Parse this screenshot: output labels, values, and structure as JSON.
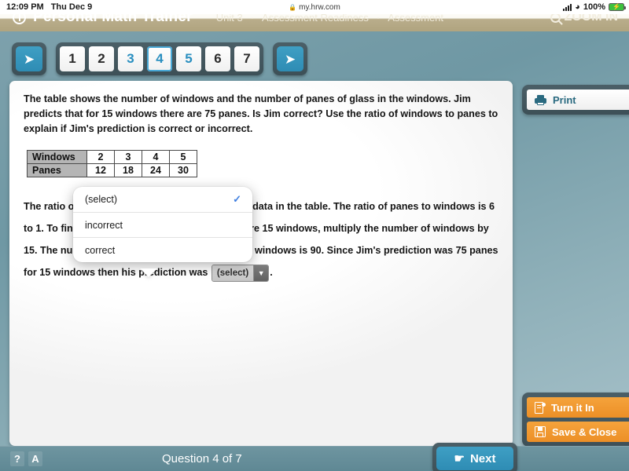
{
  "statusbar": {
    "time": "12:09 PM",
    "date": "Thu Dec 9",
    "url": "my.hrw.com",
    "lock_icon": "lock-icon",
    "signal_icon": "signal-bars-icon",
    "wifi_icon": "wifi-icon",
    "battery_pct": "100%",
    "battery_icon": "battery-charging-icon"
  },
  "header": {
    "logo_icon": "pmt-logo-icon",
    "title": "Personal Math Trainer",
    "breadcrumb": [
      "Unit 3",
      "Assessment Readiness",
      "Assessment"
    ],
    "zoom_label": "ZOOM IN",
    "zoom_icon": "magnifier-icon"
  },
  "nav": {
    "prev_icon": "arrow-left-icon",
    "next_icon": "arrow-right-icon",
    "pages": [
      {
        "label": "1",
        "state": "visited"
      },
      {
        "label": "2",
        "state": "visited"
      },
      {
        "label": "3",
        "state": "link"
      },
      {
        "label": "4",
        "state": "current"
      },
      {
        "label": "5",
        "state": "link"
      },
      {
        "label": "6",
        "state": "visited"
      },
      {
        "label": "7",
        "state": "visited"
      }
    ]
  },
  "question": {
    "prompt": "The table shows the number of windows and the number of panes of glass in the windows. Jim predicts that for 15 windows there are 75 panes. Is Jim correct? Use the ratio of windows to panes to explain if Jim's prediction is correct or incorrect.",
    "table": {
      "rows": [
        {
          "header": "Windows",
          "values": [
            "2",
            "3",
            "4",
            "5"
          ]
        },
        {
          "header": "Panes",
          "values": [
            "12",
            "18",
            "24",
            "30"
          ]
        }
      ]
    },
    "answer": {
      "part1": "The ratio of panes to windows is constant in the data in the table. The ratio of panes to windows is 6 to 1. To find how many panes there are if there are 15 windows, multiply the number of windows by 15. The number of panes there are if there are 15 windows is 90. Since Jim's prediction was 75 panes for 15 windows then his prediction was",
      "select_value": "(select)",
      "select_arrow_icon": "chevron-down-icon",
      "period": "."
    }
  },
  "dropdown": {
    "options": [
      {
        "label": "(select)",
        "selected": true
      },
      {
        "label": "incorrect",
        "selected": false
      },
      {
        "label": "correct",
        "selected": false
      }
    ],
    "check_icon": "checkmark-icon",
    "check_glyph": "✓"
  },
  "sidebar": {
    "print_label": "Print",
    "print_icon": "printer-icon",
    "turn_in_label": "Turn it In",
    "turn_in_icon": "document-submit-icon",
    "save_close_label": "Save & Close",
    "save_close_icon": "floppy-disk-icon"
  },
  "footer": {
    "help_label": "?",
    "help_icon": "question-mark-icon",
    "accessibility_label": "A",
    "accessibility_icon": "accessibility-icon",
    "question_counter": "Question 4 of 7",
    "next_label": "Next",
    "next_icon": "pointing-hand-icon"
  },
  "colors": {
    "accent_blue": "#2e8cb4",
    "panel_chrome": "#44575f",
    "orange": "#ee9228",
    "page_bg": "#7fa2ad",
    "header_tan": "#b0a47f",
    "check_blue": "#3f7fe0"
  }
}
